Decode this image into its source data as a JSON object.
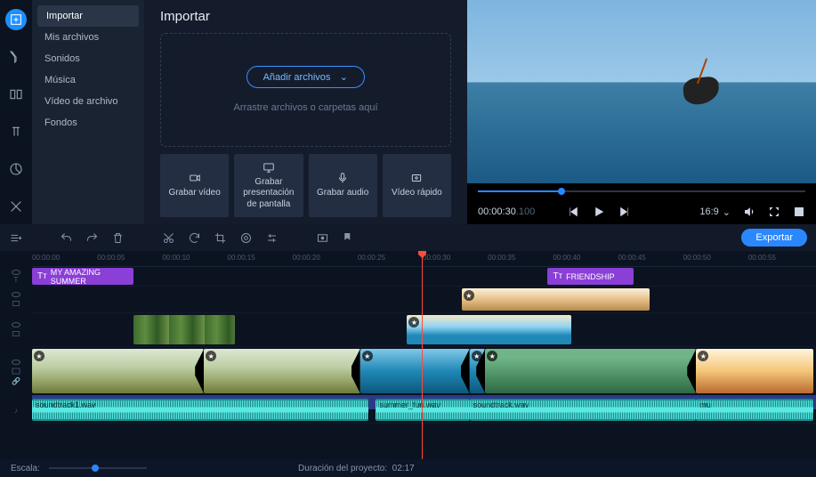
{
  "sidebar_tools": [
    {
      "name": "import-tool",
      "label": "Importar",
      "active": true
    },
    {
      "name": "filters-tool",
      "label": "Filtros",
      "active": false
    },
    {
      "name": "transitions-tool",
      "label": "Transiciones",
      "active": false
    },
    {
      "name": "titles-tool",
      "label": "Títulos",
      "active": false
    },
    {
      "name": "stickers-tool",
      "label": "Adhesivos",
      "active": false
    },
    {
      "name": "more-tools",
      "label": "Más",
      "active": false
    }
  ],
  "sidebar_items": [
    {
      "label": "Importar",
      "active": true
    },
    {
      "label": "Mis archivos",
      "active": false
    },
    {
      "label": "Sonidos",
      "active": false
    },
    {
      "label": "Música",
      "active": false
    },
    {
      "label": "Vídeo de archivo",
      "active": false
    },
    {
      "label": "Fondos",
      "active": false
    }
  ],
  "import": {
    "title": "Importar",
    "add_files": "Añadir archivos",
    "drag_hint": "Arrastre archivos o carpetas aquí",
    "record": [
      {
        "name": "record-video",
        "label": "Grabar vídeo",
        "icon": "camera"
      },
      {
        "name": "record-screen",
        "label": "Grabar presentación de pantalla",
        "icon": "monitor"
      },
      {
        "name": "record-audio",
        "label": "Grabar audio",
        "icon": "mic"
      },
      {
        "name": "quick-video",
        "label": "Vídeo rápido",
        "icon": "film"
      }
    ]
  },
  "preview": {
    "timecode": "00:00:30",
    "timecode_frac": ".100",
    "aspect": "16:9"
  },
  "timeline": {
    "export": "Exportar",
    "ticks": [
      "00:00:00",
      "00:00:05",
      "00:00:10",
      "00:00:15",
      "00:00:20",
      "00:00:25",
      "00:00:30",
      "00:00:35",
      "00:00:40",
      "00:00:45",
      "00:00:50",
      "00:00:55"
    ],
    "titles": [
      {
        "label": "MY AMAZING SUMMER",
        "start": 0,
        "end": 13
      },
      {
        "label": "FRIENDSHIP",
        "start": 66,
        "end": 77
      }
    ],
    "overlays_top": [
      {
        "start": 55,
        "end": 79,
        "kind": "sail"
      }
    ],
    "overlays_mid": [
      {
        "start": 13,
        "end": 26,
        "kind": "green"
      },
      {
        "start": 48,
        "end": 69,
        "kind": "kite"
      }
    ],
    "video_clips": [
      {
        "start": 0,
        "end": 22,
        "kind": "wild"
      },
      {
        "start": 22,
        "end": 42,
        "kind": "wild"
      },
      {
        "start": 42,
        "end": 56,
        "kind": "ocean"
      },
      {
        "start": 56,
        "end": 58,
        "kind": "ocean"
      },
      {
        "start": 58,
        "end": 85,
        "kind": "green"
      },
      {
        "start": 85,
        "end": 100,
        "kind": "sun"
      }
    ],
    "audio_clips": [
      {
        "start": 0,
        "end": 43,
        "label": "soundtrack1.wav"
      },
      {
        "start": 44,
        "end": 56,
        "label": "summer_fun.wav"
      },
      {
        "start": 56,
        "end": 85,
        "label": "soundtrack.wav"
      },
      {
        "start": 85,
        "end": 100,
        "label": "mu"
      }
    ]
  },
  "footer": {
    "scale": "Escala:",
    "duration_label": "Duración del proyecto:",
    "duration_value": "02:17"
  }
}
